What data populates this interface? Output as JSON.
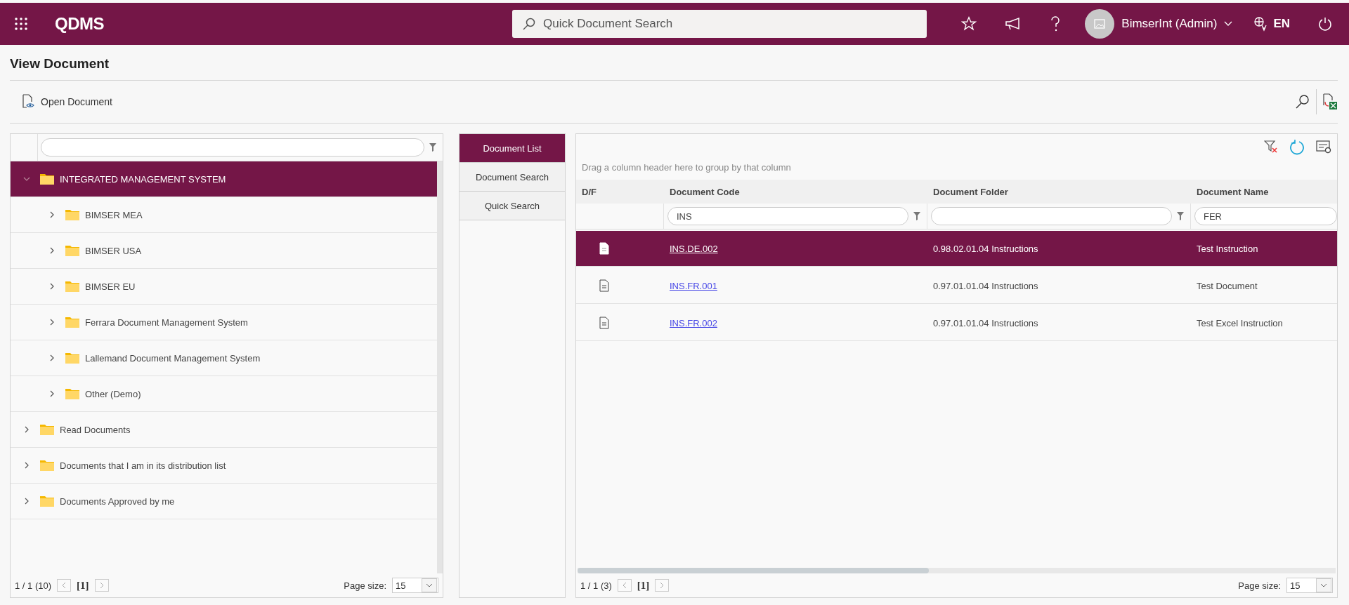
{
  "header": {
    "logo": "QDMS",
    "search": {
      "placeholder": "Quick Document Search"
    },
    "user": "BimserInt (Admin)",
    "language": "EN"
  },
  "page": {
    "title": "View Document"
  },
  "toolbar": {
    "open_button": "Open Document"
  },
  "tree": {
    "items": [
      {
        "label": "INTEGRATED MANAGEMENT SYSTEM",
        "selected": true,
        "expanded": true,
        "children": [
          {
            "label": "BIMSER MEA",
            "selected": false,
            "expanded": false
          },
          {
            "label": "BIMSER USA",
            "selected": false,
            "expanded": false
          },
          {
            "label": "BIMSER EU",
            "selected": false,
            "expanded": false
          },
          {
            "label": "Ferrara Document Management System",
            "selected": false,
            "expanded": false
          },
          {
            "label": "Lallemand Document Management System",
            "selected": false,
            "expanded": false
          },
          {
            "label": "Other (Demo)",
            "selected": false,
            "expanded": false
          }
        ]
      },
      {
        "label": "Read Documents",
        "selected": false,
        "expanded": false
      },
      {
        "label": "Documents that I am in its distribution list",
        "selected": false,
        "expanded": false
      },
      {
        "label": "Documents Approved by me",
        "selected": false,
        "expanded": false
      }
    ],
    "pager": {
      "summary": "1 / 1 (10)",
      "current": "[1]",
      "page_size_label": "Page size:",
      "page_size": "15"
    }
  },
  "tabs": [
    {
      "label": "Document List",
      "selected": true
    },
    {
      "label": "Document Search",
      "selected": false
    },
    {
      "label": "Quick Search",
      "selected": false
    }
  ],
  "grid": {
    "group_hint": "Drag a column header here to group by that column",
    "columns": [
      {
        "label": "D/F",
        "kind": "plain"
      },
      {
        "label": "Document Code",
        "kind": "filter",
        "filter": "INS"
      },
      {
        "label": "Document Folder",
        "kind": "filter"
      },
      {
        "label": "Document Name",
        "kind": "filter",
        "filter": "FER"
      }
    ],
    "rows": [
      {
        "selected": true,
        "code": "INS.DE.002",
        "folder": "0.98.02.01.04 Instructions",
        "name": "Test Instruction"
      },
      {
        "selected": false,
        "code": "INS.FR.001",
        "folder": "0.97.01.01.04 Instructions",
        "name": "Test Document"
      },
      {
        "selected": false,
        "code": "INS.FR.002",
        "folder": "0.97.01.01.04 Instructions",
        "name": "Test Excel Instruction"
      }
    ],
    "pager": {
      "summary": "1 / 1 (3)",
      "current": "[1]",
      "page_size_label": "Page size:",
      "page_size": "15"
    }
  }
}
